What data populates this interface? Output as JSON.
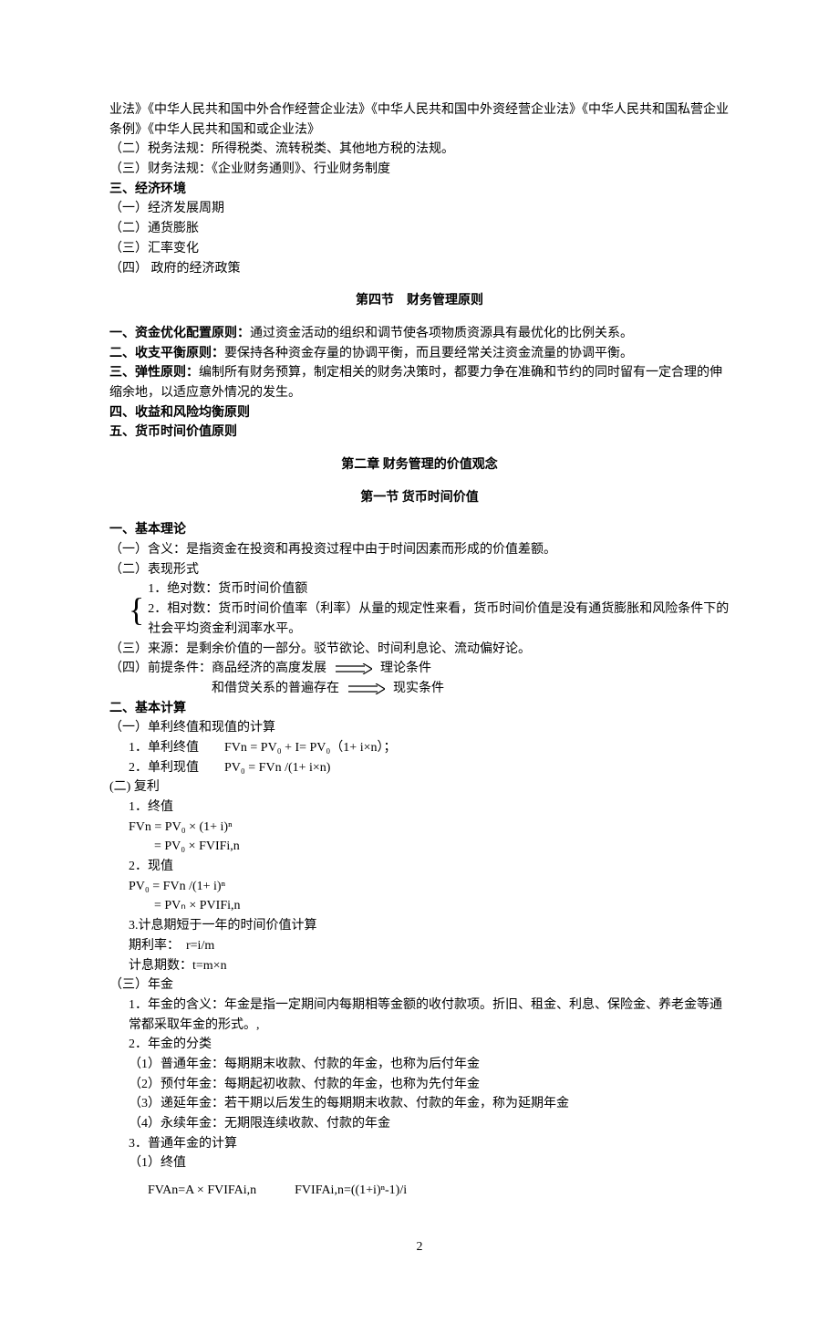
{
  "top": {
    "line1": "业法》《中华人民共和国中外合作经营企业法》《中华人民共和国中外资经营企业法》《中华人民共和国私营企业条例》《中华人民共和国和或企业法》",
    "line2": "（二）税务法规：所得税类、流转税类、其他地方税的法规。",
    "line3": "（三）财务法规：《企业财务通则》、行业财务制度"
  },
  "env": {
    "heading": "三、经济环境",
    "i1": "（一）经济发展周期",
    "i2": "（二）通货膨胀",
    "i3": "（三）汇率变化",
    "i4": "（四） 政府的经济政策"
  },
  "s4": {
    "title": "第四节　财务管理原则",
    "p1a": "一、资金优化配置原则：",
    "p1b": "通过资金活动的组织和调节使各项物质资源具有最优化的比例关系。",
    "p2a": "二、收支平衡原则：",
    "p2b": "要保持各种资金存量的协调平衡，而且要经常关注资金流量的协调平衡。",
    "p3a": "三、弹性原则：",
    "p3b": "编制所有财务预算，制定相关的财务决策时，都要力争在准确和节约的同时留有一定合理的伸缩余地，以适应意外情况的发生。",
    "p4": "四、收益和风险均衡原则",
    "p5": "五、货币时间价值原则"
  },
  "ch2": {
    "title": "第二章 财务管理的价值观念",
    "s1title": "第一节 货币时间价值"
  },
  "basic": {
    "heading": "一、基本理论",
    "l1": "（一）含义：是指资金在投资和再投资过程中由于时间因素而形成的价值差额。",
    "l2": "（二）表现形式",
    "b1": "1．绝对数：货币时间价值额",
    "b2": "2．相对数：货币时间价值率（利率）从量的规定性来看，货币时间价值是没有通货膨胀和风险条件下的社会平均资金利润率水平。",
    "l3": "（三）来源：是剩余价值的一部分。驳节欲论、时间利息论、流动偏好论。",
    "l4a": "（四）前提条件：商品经济的高度发展",
    "l4b": "理论条件",
    "l5a": "和借贷关系的普遍存在",
    "l5b": "现实条件"
  },
  "calc": {
    "heading": "二、基本计算",
    "c1": "（一）单利终值和现值的计算",
    "c1_1": "1．单利终值　　FVn = PV₀ + I= PV₀（1+ i×n）；",
    "c1_2": "2．单利现值　　PV₀ = FVn /(1+ i×n)",
    "c2": "(二) 复利",
    "c2_1": "1．终值",
    "c2_1f1": "FVn = PV₀ × (1+ i)ⁿ",
    "c2_1f2": "　　= PV₀ × FVIFi,n",
    "c2_2": "2．现值",
    "c2_2f1": "PV₀ = FVn /(1+ i)ⁿ",
    "c2_2f2": "　　= PVₙ × PVIFi,n",
    "c2_3": "3.计息期短于一年的时间价值计算",
    "c2_3a": "期利率：　r=i/m",
    "c2_3b": "计息期数：t=m×n",
    "c3": "（三）年金",
    "c3_1": "1．年金的含义：年金是指一定期间内每期相等金额的收付款项。折旧、租金、利息、保险金、养老金等通常都采取年金的形式。,",
    "c3_2": "2．年金的分类",
    "c3_2a": "（1）普通年金：每期期末收款、付款的年金，也称为后付年金",
    "c3_2b": "（2）预付年金：每期起初收款、付款的年金，也称为先付年金",
    "c3_2c": "（3）递延年金：若干期以后发生的每期期末收款、付款的年金，称为延期年金",
    "c3_2d": "（4）永续年金：无期限连续收款、付款的年金",
    "c3_3": "3．普通年金的计算",
    "c3_3a": "（1）终值",
    "c3_3f": "FVAn=A × FVIFAi,n　　　FVIFAi,n=((1+i)ⁿ-1)/i"
  },
  "page": "2"
}
